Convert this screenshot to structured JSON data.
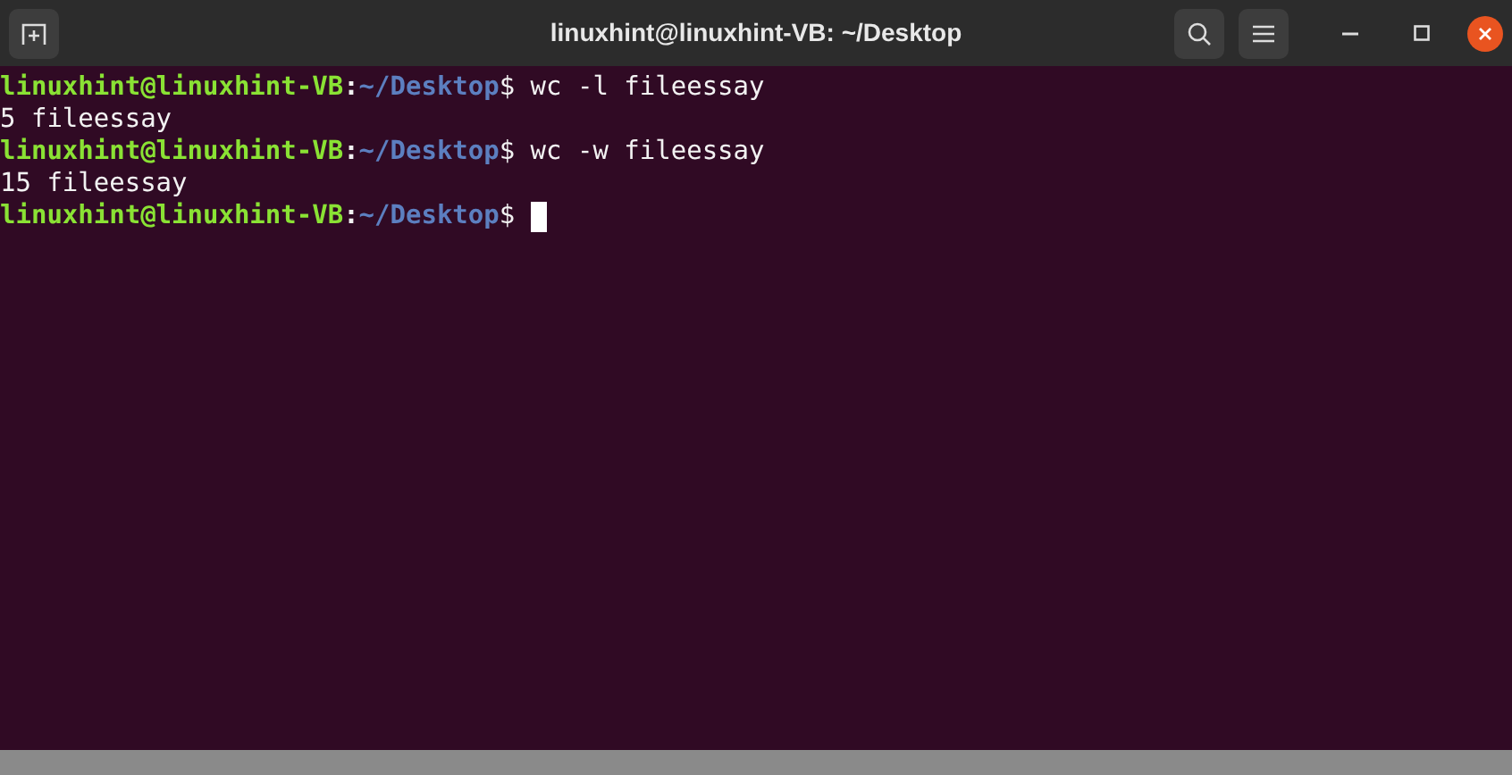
{
  "window": {
    "title": "linuxhint@linuxhint-VB: ~/Desktop"
  },
  "terminal": {
    "lines": [
      {
        "kind": "prompt",
        "user": "linuxhint@linuxhint-VB",
        "separator": ":",
        "path": "~/Desktop",
        "symbol": "$",
        "command": "wc -l fileessay",
        "cursor": false
      },
      {
        "kind": "output",
        "text": "5 fileessay"
      },
      {
        "kind": "prompt",
        "user": "linuxhint@linuxhint-VB",
        "separator": ":",
        "path": "~/Desktop",
        "symbol": "$",
        "command": "wc -w fileessay",
        "cursor": false
      },
      {
        "kind": "output",
        "text": "15 fileessay"
      },
      {
        "kind": "prompt",
        "user": "linuxhint@linuxhint-VB",
        "separator": ":",
        "path": "~/Desktop",
        "symbol": "$",
        "cursor": true
      }
    ]
  }
}
